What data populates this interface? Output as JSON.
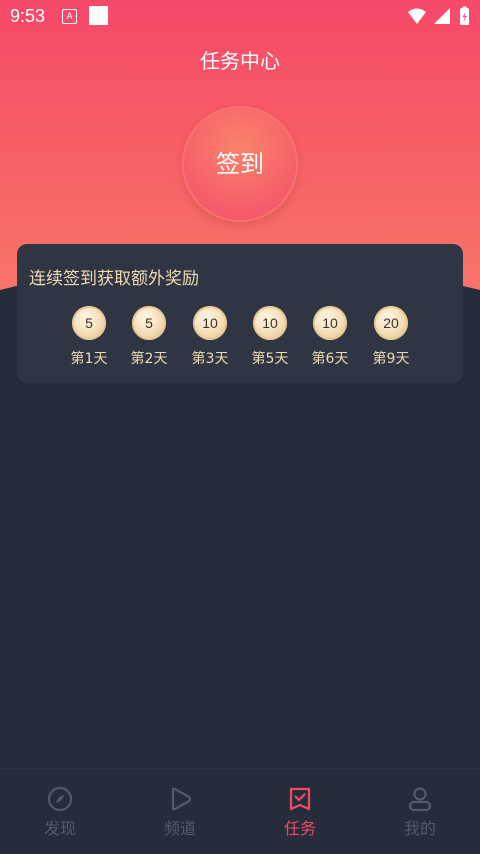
{
  "status_bar": {
    "time": "9:53",
    "notif_icon": "A"
  },
  "header": {
    "title": "任务中心"
  },
  "sign_in": {
    "label": "签到"
  },
  "streak_card": {
    "title": "连续签到获取额外奖励",
    "rewards": [
      {
        "points": "5",
        "day": "第1天"
      },
      {
        "points": "5",
        "day": "第2天"
      },
      {
        "points": "10",
        "day": "第3天"
      },
      {
        "points": "10",
        "day": "第5天"
      },
      {
        "points": "10",
        "day": "第6天"
      },
      {
        "points": "20",
        "day": "第9天"
      }
    ]
  },
  "tabbar": {
    "items": [
      {
        "label": "发现",
        "icon": "compass-icon"
      },
      {
        "label": "频道",
        "icon": "play-icon"
      },
      {
        "label": "任务",
        "icon": "task-icon"
      },
      {
        "label": "我的",
        "icon": "user-icon"
      }
    ],
    "active_index": 2
  },
  "colors": {
    "accent": "#f04a67",
    "card_text": "#f0d9b5",
    "background": "#262c39"
  }
}
